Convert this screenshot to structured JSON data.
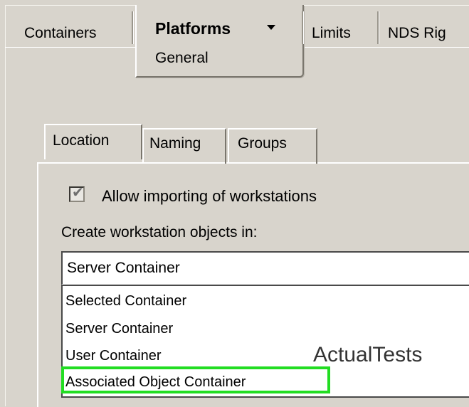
{
  "top_tabs": [
    {
      "label": "Containers"
    },
    {
      "label": "Platforms",
      "sublabel": "General",
      "active": true
    },
    {
      "label": "Limits"
    },
    {
      "label": "NDS Rig"
    }
  ],
  "inner_tabs": [
    {
      "label": "Location",
      "active": true
    },
    {
      "label": "Naming"
    },
    {
      "label": "Groups"
    }
  ],
  "import_checkbox": {
    "label": "Allow importing of workstations",
    "checked": true
  },
  "create_in": {
    "label": "Create workstation objects in:",
    "selected": "Server Container",
    "options": [
      "Selected Container",
      "Server Container",
      "User Container",
      "Associated Object Container"
    ],
    "highlighted_option": "Associated Object Container"
  },
  "watermark": "ActualTests",
  "colors": {
    "background": "#d8d4cc",
    "highlight_box": "#22dd22"
  },
  "icons": {
    "dropdown": "triangle-down",
    "checkbox": "checkmark"
  }
}
